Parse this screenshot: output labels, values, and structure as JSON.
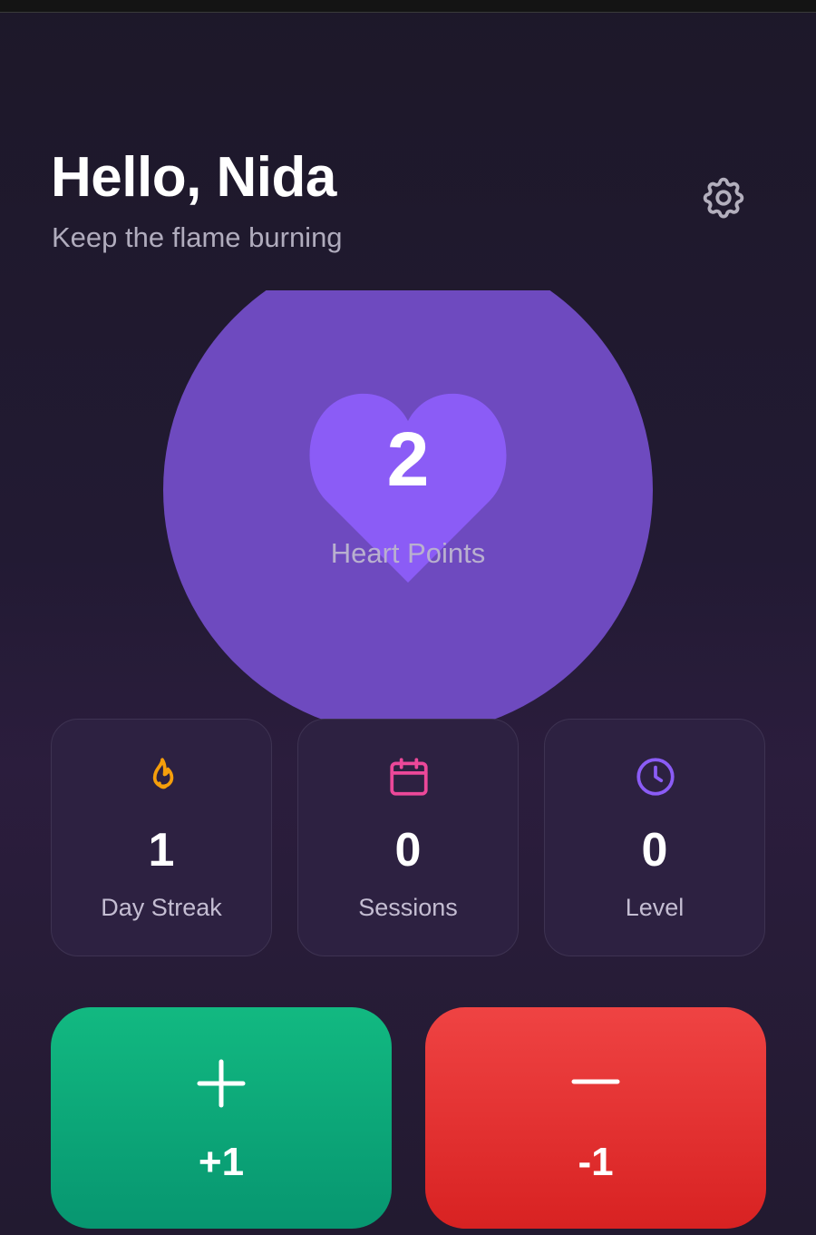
{
  "header": {
    "greeting": "Hello, Nida",
    "subtitle": "Keep the flame burning"
  },
  "icons": {
    "settings": "gear-icon",
    "streak": "flame-icon",
    "sessions": "calendar-icon",
    "level": "clock-icon",
    "plus": "plus-icon",
    "minus": "minus-icon"
  },
  "hero": {
    "value": "2",
    "label": "Heart Points"
  },
  "stats": [
    {
      "value": "1",
      "label": "Day Streak",
      "color": "#f59e0b"
    },
    {
      "value": "0",
      "label": "Sessions",
      "color": "#ec4899"
    },
    {
      "value": "0",
      "label": "Level",
      "color": "#8b5cf6"
    }
  ],
  "actions": {
    "increment_label": "+1",
    "decrement_label": "-1",
    "increment_color": "#10b981",
    "decrement_color": "#ef4444"
  },
  "colors": {
    "accent": "#8b5cf6",
    "orb": "#6e4abf"
  }
}
